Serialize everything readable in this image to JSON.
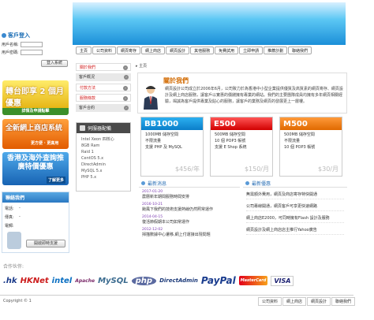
{
  "nav": {
    "items": [
      "主頁",
      "公司資料",
      "網頁寄存",
      "網上商店",
      "網頁設計",
      "其他服務",
      "免費試用",
      "立即申請",
      "推薦計劃",
      "聯絡我們"
    ]
  },
  "login": {
    "title": "客戶登入",
    "username_label": "用戶名稱:",
    "password_label": "用戶密碼:",
    "submit_label": "登入系統"
  },
  "promos": {
    "promo1_main": "轉台即享 2 個月優惠",
    "promo1_sub": "詳情及申請點擊",
    "promo2_main": "全新網上商店系統",
    "promo2_sub": "更方便 · 更高用",
    "promo3_main": "香港及海外查詢推廣特價優惠",
    "promo3_sub": "了解更多"
  },
  "contact": {
    "title": "聯絡我們",
    "phone_label": "電話:",
    "phone_value": "-",
    "fax_label": "傳真:",
    "fax_value": "-",
    "email_label": "電郵:",
    "email_value": "",
    "button_label": "開啟即時支援"
  },
  "side_menu": {
    "items": [
      "關於我們",
      "客戶概況",
      "付款方法",
      "服務條款",
      "客戶合約"
    ]
  },
  "servers": {
    "title": "伺服器配備",
    "items": [
      "Intel Xeon 四核心",
      "8GB Ram",
      "Raid 1",
      "CentOS 5.x",
      "DirectAdmin",
      "MySQL 5.x",
      "PHP 5.x"
    ]
  },
  "breadcrumb": "主頁",
  "about": {
    "title": "關於我們",
    "body": "網頁設計公司成立於2006年6月，公司致力於為香港中小型企業提供優質及高質素的網頁寄存、網頁設計及網上商店服務，讓客戶以實惠的價錢擁有專業的網站。我們的主要團隊成員均擁有多年網頁相關經驗，竭誠為客戶提供專業及貼心的服務，讓客戶的業務及網頁的發展更上一層樓。"
  },
  "plans": [
    {
      "name": "BB1000",
      "lines": [
        "1000MB 儲存空間",
        "不限流量",
        "支援 PHP 及 MySQL"
      ],
      "price": "$456/年"
    },
    {
      "name": "E500",
      "lines": [
        "500MB 儲存空間",
        "10 個 POP3 帳號",
        "支援 E Shop 系統"
      ],
      "price": "$150/月"
    },
    {
      "name": "M500",
      "lines": [
        "500MB 儲存空間",
        "不限流量",
        "10 個 POP3 帳號"
      ],
      "price": "$30/月"
    }
  ],
  "latest": {
    "title": "最新消息",
    "items": [
      {
        "date": "2017-01-20",
        "text": "農曆新年期間服務時間安排"
      },
      {
        "date": "2016-10-21",
        "text": "颱風下我們的技術支援熱線仍然照常運作"
      },
      {
        "date": "2014-04-15",
        "text": "復活節假期本公司如常運作"
      },
      {
        "date": "2012-12-02",
        "text": "掃描數據中心遷移,網上付運接出現問題"
      }
    ]
  },
  "offers": {
    "title": "最新優惠",
    "items": [
      "無需額外費用，網頁及商店寄存特快開通",
      "公司專線開通，網頁客戶可享更快速網路",
      "網上商店E2000，可同時擁有Flash 設計及服務",
      "網頁設計及網上商店店主推行Yahoo廣告"
    ]
  },
  "partners": {
    "title": "合作伙伴:",
    "logos": [
      ".hk",
      "HKNet",
      "intel",
      "Apache",
      "MySQL",
      "php",
      "DirectAdmin",
      "PayPal",
      "MasterCard",
      "VISA"
    ]
  },
  "footer": {
    "copyright": "Copyright © 1",
    "links": [
      "公司資料",
      "網上商店",
      "網頁設計",
      "聯絡我們"
    ]
  },
  "colors": {
    "brand_blue": "#1b8fd8",
    "accent_orange": "#d26a00",
    "active_red": "#d21e1e"
  }
}
